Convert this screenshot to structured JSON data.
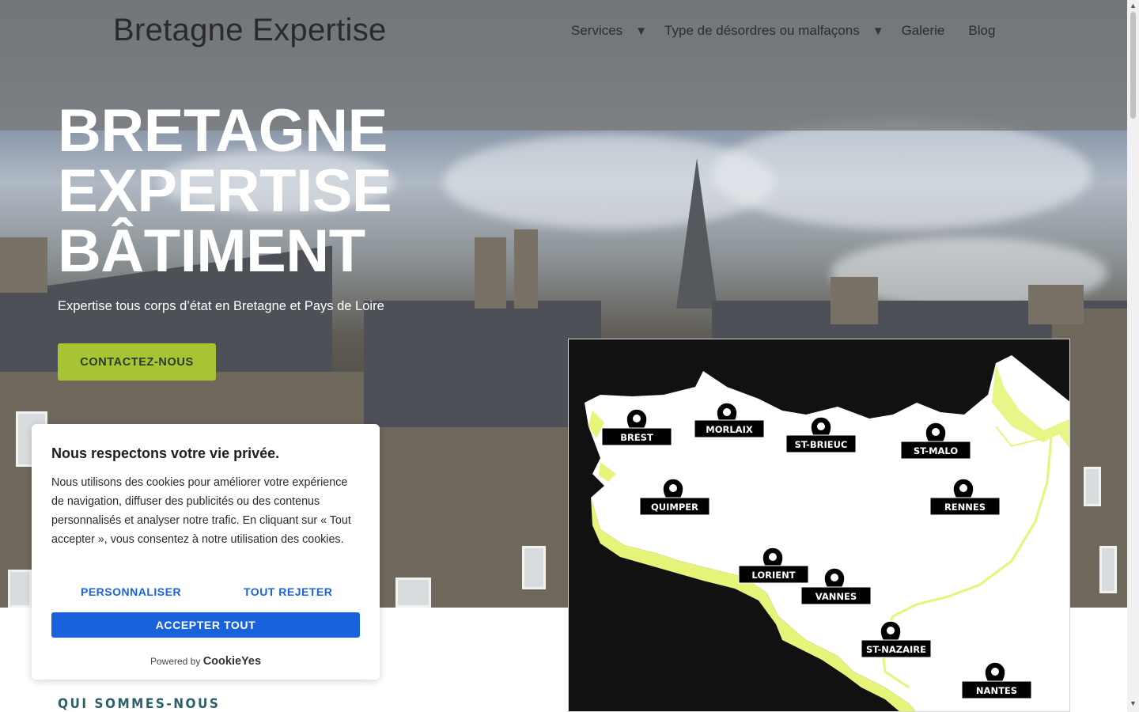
{
  "header": {
    "site_title": "Bretagne Expertise",
    "nav": [
      {
        "label": "Services",
        "has_dropdown": true
      },
      {
        "label": "Type de désordres ou malfaçons",
        "has_dropdown": true
      },
      {
        "label": "Galerie",
        "has_dropdown": false
      },
      {
        "label": "Blog",
        "has_dropdown": false
      }
    ],
    "dropdown_glyph": "▼"
  },
  "hero": {
    "title_lines": [
      "BRETAGNE",
      "EXPERTISE",
      "BÂTIMENT"
    ],
    "subtitle": "Expertise tous corps d’état en Bretagne et Pays de Loire",
    "cta_label": "CONTACTEZ-NOUS"
  },
  "map": {
    "cities": [
      "BREST",
      "MORLAIX",
      "ST-BRIEUC",
      "ST-MALO",
      "QUIMPER",
      "RENNES",
      "LORIENT",
      "VANNES",
      "ST-NAZAIRE",
      "NANTES"
    ]
  },
  "section": {
    "label": "QUI SOMMES-NOUS"
  },
  "cookie_banner": {
    "title": "Nous respectons votre vie privée.",
    "body": "Nous utilisons des cookies pour améliorer votre expérience de navigation, diffuser des publicités ou des contenus personnalisés et analyser notre trafic. En cliquant sur « Tout accepter », vous consentez à notre utilisation des cookies.",
    "customize_label": "PERSONNALISER",
    "reject_label": "TOUT REJETER",
    "accept_label": "ACCEPTER TOUT",
    "powered_by": "Powered by",
    "brand": "CookieYes"
  },
  "colors": {
    "cta": "#a7c532",
    "cookie_accent": "#1863dc",
    "section_label": "#2d5f6b",
    "map_coast": "#e6f57a"
  }
}
